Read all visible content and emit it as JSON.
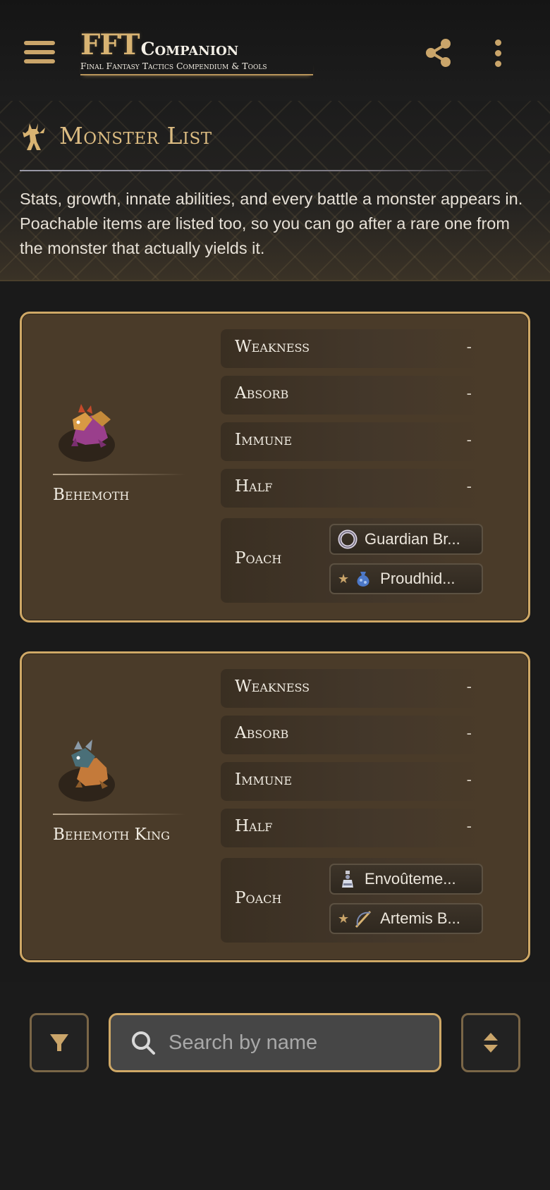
{
  "app": {
    "logo_fft": "FFT",
    "logo_companion": "Companion",
    "logo_subtitle": "Final Fantasy Tactics Compendium & Tools",
    "icons": {
      "menu": "hamburger-menu-icon",
      "share": "share-icon",
      "more": "more-vertical-icon"
    }
  },
  "page": {
    "title": "Monster List",
    "description": "Stats, growth, innate abilities, and every battle a monster appears in. Poachable items are listed too, so you can go after a rare one from the monster that actually yields it."
  },
  "labels": {
    "weakness": "Weakness",
    "absorb": "Absorb",
    "immune": "Immune",
    "half": "Half",
    "poach": "Poach"
  },
  "monsters": [
    {
      "name": "Behemoth",
      "weakness": "-",
      "absorb": "-",
      "immune": "-",
      "half": "-",
      "poach": [
        {
          "name": "Guardian Br...",
          "rare": false,
          "icon": "bracelet-icon"
        },
        {
          "name": "Proudhid...",
          "rare": true,
          "icon": "pouch-icon"
        }
      ]
    },
    {
      "name": "Behemoth King",
      "weakness": "-",
      "absorb": "-",
      "immune": "-",
      "half": "-",
      "poach": [
        {
          "name": "Envoûteme...",
          "rare": false,
          "icon": "potion-icon"
        },
        {
          "name": "Artemis B...",
          "rare": true,
          "icon": "bow-icon"
        }
      ]
    }
  ],
  "search": {
    "placeholder": "Search by name",
    "value": ""
  },
  "colors": {
    "accent": "#cfa866",
    "card_bg": "#4a3b29",
    "background": "#1a1a1a"
  }
}
